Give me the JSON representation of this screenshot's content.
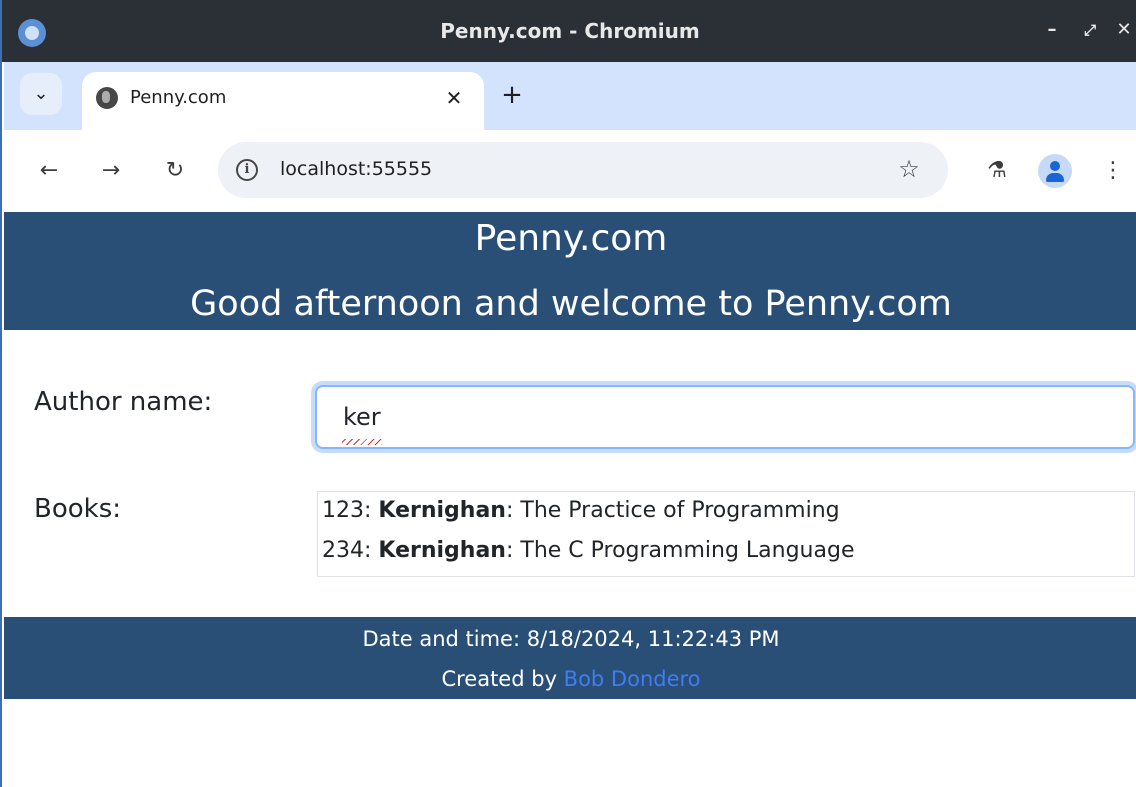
{
  "window": {
    "title": "Penny.com - Chromium",
    "controls": {
      "minimize": "–",
      "maximize": "⤢",
      "close": "✕"
    }
  },
  "tabs": {
    "search_icon": "⌄",
    "active_tab": {
      "title": "Penny.com",
      "close": "✕"
    },
    "new_tab": "+"
  },
  "toolbar": {
    "back": "←",
    "forward": "→",
    "reload": "↻",
    "info_icon": "i",
    "url": "localhost:55555",
    "bookmark": "☆",
    "labs": "⚗",
    "menu": "⋮"
  },
  "page": {
    "site_title": "Penny.com",
    "greeting": "Good afternoon and welcome to Penny.com",
    "author_label": "Author name:",
    "author_value": "ker",
    "books_label": "Books:",
    "books": [
      {
        "id": "123",
        "author": "Kernighan",
        "title": "The Practice of Programming"
      },
      {
        "id": "234",
        "author": "Kernighan",
        "title": "The C Programming Language"
      }
    ],
    "footer": {
      "datetime": "Date and time: 8/18/2024, 11:22:43 PM",
      "created_by": "Created by ",
      "author_link": "Bob Dondero"
    }
  },
  "colors": {
    "header_bg": "#2a4f77",
    "link": "#3f7df0",
    "tabstrip_bg": "#d3e3fd",
    "titlebar_bg": "#2b2f36"
  }
}
